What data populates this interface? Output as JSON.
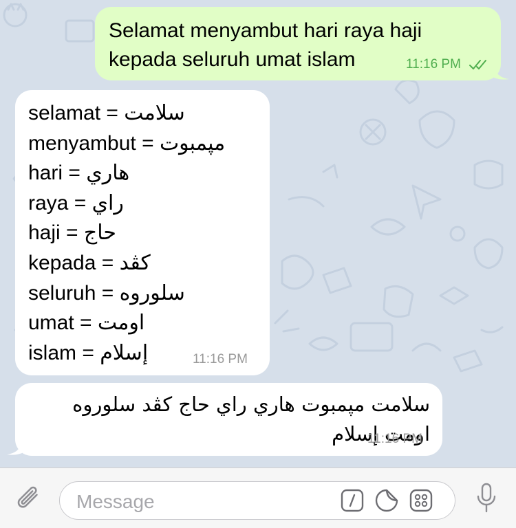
{
  "messages": {
    "outgoing": {
      "line1": "Selamat menyambut hari raya haji",
      "line2": "kepada seluruh umat islam",
      "time": "11:16 PM",
      "status": "double-check-icon"
    },
    "dictionary": {
      "lines": [
        {
          "latin": "selamat =",
          "arabic": "سلامت"
        },
        {
          "latin": "menyambut =",
          "arabic": "مپمبوت"
        },
        {
          "latin": "hari =",
          "arabic": "هاري"
        },
        {
          "latin": "raya =",
          "arabic": "راي"
        },
        {
          "latin": "haji =",
          "arabic": "حاج"
        },
        {
          "latin": "kepada =",
          "arabic": "كڤد"
        },
        {
          "latin": "seluruh =",
          "arabic": "سلوروه"
        },
        {
          "latin": "umat =",
          "arabic": "اومت"
        },
        {
          "latin": "islam =",
          "arabic": "إسلام"
        }
      ],
      "time": "11:16 PM"
    },
    "jawi": {
      "line1": "سلامت مپمبوت هاري راي حاج  كڤد سلوروه",
      "line2": "اومت إسلام",
      "time": "11:16 PM"
    }
  },
  "composer": {
    "placeholder": "Message",
    "icons": [
      "attach-icon",
      "command-icon",
      "sticker-icon",
      "emoji-panel-icon",
      "microphone-icon"
    ]
  },
  "colors": {
    "background": "#d6dfea",
    "outgoing_bubble": "#e1fec6",
    "incoming_bubble": "#ffffff",
    "check_green": "#4fae4e",
    "icon_gray": "#8e8e93"
  }
}
